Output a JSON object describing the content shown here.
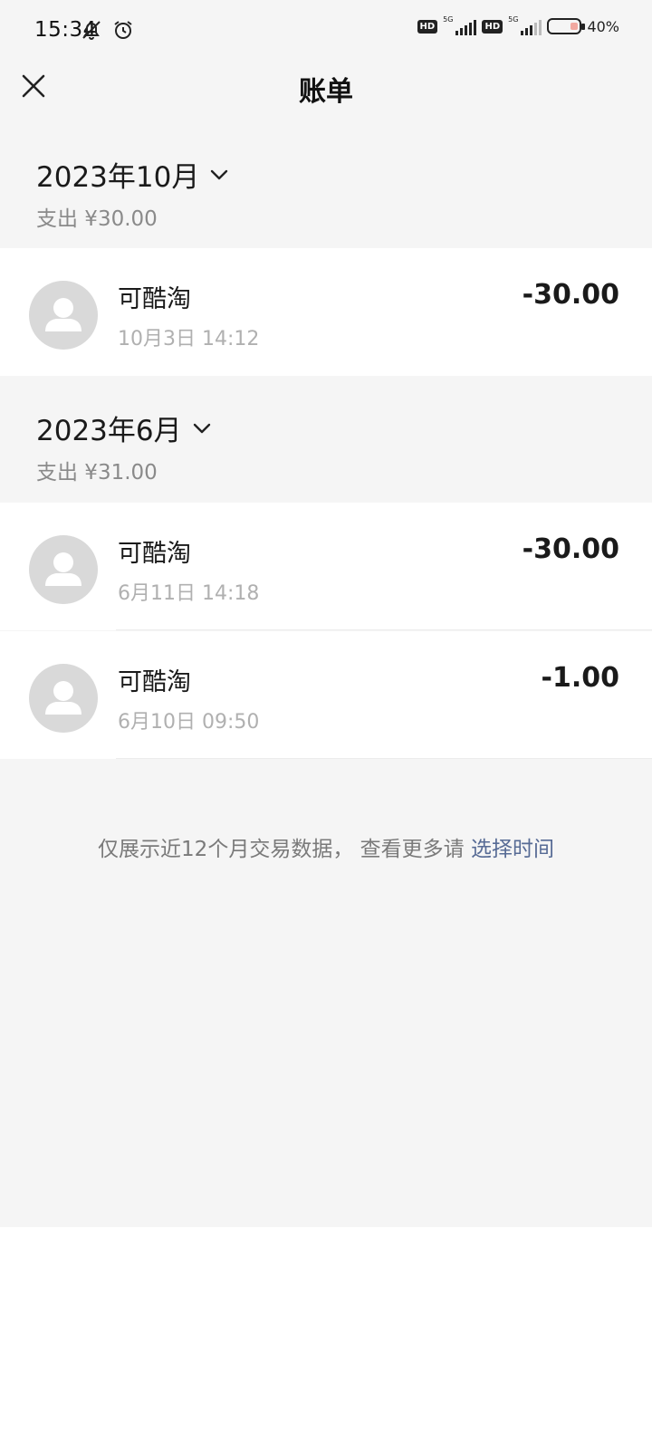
{
  "status_bar": {
    "time": "15:34",
    "battery": "40%",
    "network": "5G",
    "hd": "HD"
  },
  "header": {
    "title": "账单",
    "close_icon": "close-icon"
  },
  "months": [
    {
      "title": "2023年10月",
      "summary": "支出 ¥30.00",
      "transactions": [
        {
          "name": "可酷淘",
          "date": "10月3日 14:12",
          "amount": "-30.00"
        }
      ]
    },
    {
      "title": "2023年6月",
      "summary": "支出 ¥31.00",
      "transactions": [
        {
          "name": "可酷淘",
          "date": "6月11日 14:18",
          "amount": "-30.00"
        },
        {
          "name": "可酷淘",
          "date": "6月10日 09:50",
          "amount": "-1.00"
        }
      ]
    }
  ],
  "footer": {
    "note": "仅展示近12个月交易数据， 查看更多请 ",
    "link": "选择时间"
  },
  "colors": {
    "background_gray": "#f5f5f5",
    "link_blue": "#576b95",
    "avatar_gray": "#d9d9d9"
  }
}
